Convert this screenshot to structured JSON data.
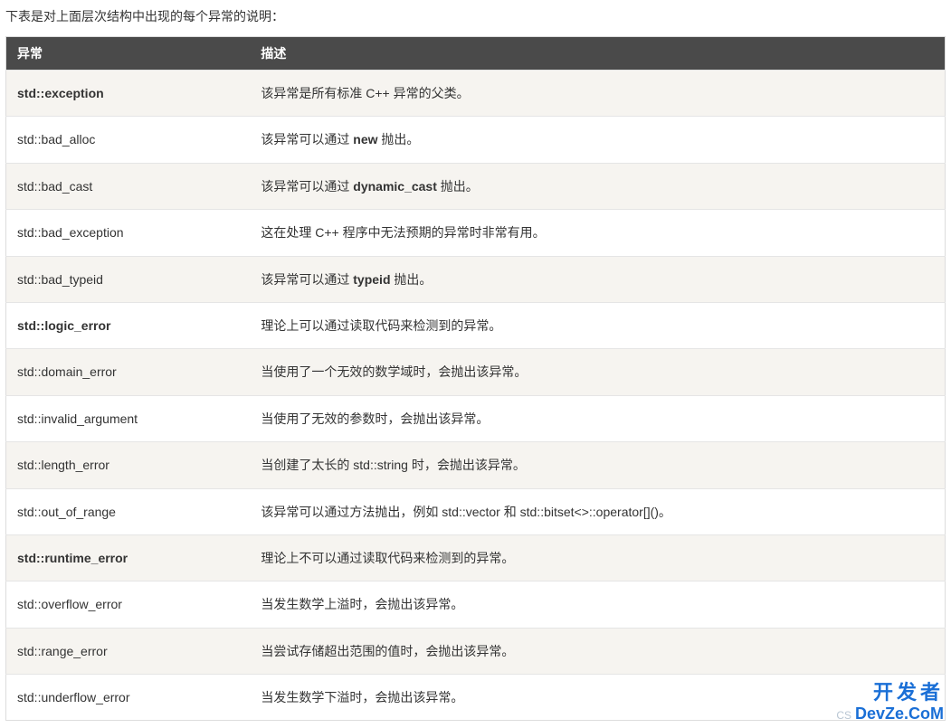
{
  "intro": "下表是对上面层次结构中出现的每个异常的说明：",
  "headers": {
    "exception": "异常",
    "description": "描述"
  },
  "rows": [
    {
      "name": "std::exception",
      "bold": true,
      "desc_parts": [
        {
          "t": "该异常是所有标准 C++ 异常的父类。",
          "b": false
        }
      ]
    },
    {
      "name": "std::bad_alloc",
      "bold": false,
      "desc_parts": [
        {
          "t": "该异常可以通过 ",
          "b": false
        },
        {
          "t": "new",
          "b": true
        },
        {
          "t": " 抛出。",
          "b": false
        }
      ]
    },
    {
      "name": "std::bad_cast",
      "bold": false,
      "desc_parts": [
        {
          "t": "该异常可以通过 ",
          "b": false
        },
        {
          "t": "dynamic_cast",
          "b": true
        },
        {
          "t": " 抛出。",
          "b": false
        }
      ]
    },
    {
      "name": "std::bad_exception",
      "bold": false,
      "desc_parts": [
        {
          "t": "这在处理 C++ 程序中无法预期的异常时非常有用。",
          "b": false
        }
      ]
    },
    {
      "name": "std::bad_typeid",
      "bold": false,
      "desc_parts": [
        {
          "t": "该异常可以通过 ",
          "b": false
        },
        {
          "t": "typeid",
          "b": true
        },
        {
          "t": " 抛出。",
          "b": false
        }
      ]
    },
    {
      "name": "std::logic_error",
      "bold": true,
      "desc_parts": [
        {
          "t": "理论上可以通过读取代码来检测到的异常。",
          "b": false
        }
      ]
    },
    {
      "name": "std::domain_error",
      "bold": false,
      "desc_parts": [
        {
          "t": "当使用了一个无效的数学域时，会抛出该异常。",
          "b": false
        }
      ]
    },
    {
      "name": "std::invalid_argument",
      "bold": false,
      "desc_parts": [
        {
          "t": "当使用了无效的参数时，会抛出该异常。",
          "b": false
        }
      ]
    },
    {
      "name": "std::length_error",
      "bold": false,
      "desc_parts": [
        {
          "t": "当创建了太长的 std::string 时，会抛出该异常。",
          "b": false
        }
      ]
    },
    {
      "name": "std::out_of_range",
      "bold": false,
      "desc_parts": [
        {
          "t": "该异常可以通过方法抛出，例如 std::vector 和 std::bitset<>::operator[]()。",
          "b": false
        }
      ]
    },
    {
      "name": "std::runtime_error",
      "bold": true,
      "desc_parts": [
        {
          "t": "理论上不可以通过读取代码来检测到的异常。",
          "b": false
        }
      ]
    },
    {
      "name": "std::overflow_error",
      "bold": false,
      "desc_parts": [
        {
          "t": "当发生数学上溢时，会抛出该异常。",
          "b": false
        }
      ]
    },
    {
      "name": "std::range_error",
      "bold": false,
      "desc_parts": [
        {
          "t": "当尝试存储超出范围的值时，会抛出该异常。",
          "b": false
        }
      ]
    },
    {
      "name": "std::underflow_error",
      "bold": false,
      "desc_parts": [
        {
          "t": "当发生数学下溢时，会抛出该异常。",
          "b": false
        }
      ]
    }
  ],
  "watermark": {
    "line1": "开发者",
    "line2_faint": "CS",
    "line2": "DevZe.CoM"
  }
}
